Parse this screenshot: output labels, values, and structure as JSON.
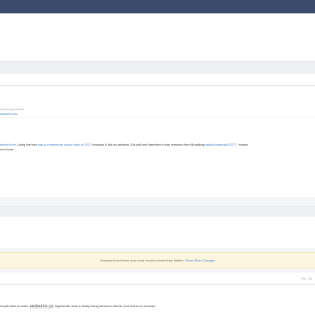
{
  "section_meta": {
    "line1": "some experience",
    "link": "default fonts."
  },
  "comment": {
    "segment1": "default font",
    "segment2": ". Using the font ",
    "segment3": "was a commercial choice back in 2017",
    "segment4": " because it did not address 10k well and therefore it was removed from Bootstrap ",
    "segment5": "twbs/bootstrap#23277",
    "segment6": ". Howev",
    "line2": "rent fonts."
  },
  "notice": {
    "text": "Changes from before your most recent comment are hidden.",
    "link": "Show Older Changes"
  },
  "pager": {
    "text": "Thu, Jul"
  },
  "footer_line": {
    "prefix": "ompile time to make ",
    "code": "unibuild.js",
    "suffix": " regenerate what is finally being served to clients. And that is no success."
  }
}
